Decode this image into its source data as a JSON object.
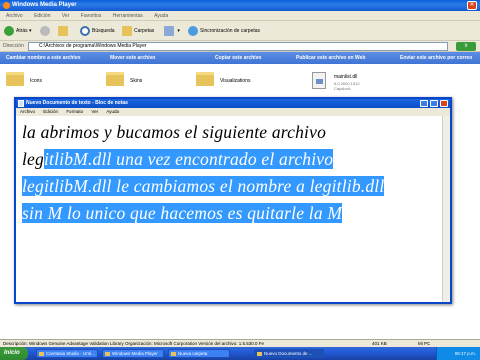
{
  "explorer": {
    "title": "Windows Media Player",
    "menu": [
      "Archivo",
      "Edición",
      "Ver",
      "Favoritos",
      "Herramientas",
      "Ayuda"
    ],
    "toolbar": {
      "back": "Atrás",
      "search": "Búsqueda",
      "folders": "Carpetas",
      "sync": "Sincronización de carpetas"
    },
    "address_label": "Dirección",
    "address_value": "C:\\Archivos de programa\\Windows Media Player",
    "go_label": "Ir",
    "tasks": [
      "Cambiar nombre a este archivo",
      "Mover este archivo",
      "Copiar este archivo",
      "Publicar este archivo en Web",
      "Enviar este archivo por correo"
    ],
    "items": [
      {
        "name": "Icons",
        "type": "folder"
      },
      {
        "name": "Skins",
        "type": "folder"
      },
      {
        "name": "Visualizations",
        "type": "folder"
      },
      {
        "name": "mainlist.dll",
        "meta1": "6.0.2600.1512",
        "meta2": "Capslock",
        "type": "file"
      }
    ]
  },
  "notepad": {
    "title": "Nuevo Documento de texto - Bloc de notas",
    "menu": [
      "Archivo",
      "Edición",
      "Formato",
      "Ver",
      "Ayuda"
    ],
    "lines": [
      {
        "plain": "la abrimos y bucamos el siguiente archivo",
        "selected": ""
      },
      {
        "plain": "leg",
        "selected": "itlibM.dll una vez encontrado el archivo"
      },
      {
        "plain": "",
        "selected": "legitlibM.dll le cambiamos el nombre a legitlib.dll"
      },
      {
        "plain": "",
        "selected": "sin M lo unico que hacemos es quitarle la M"
      }
    ]
  },
  "statusbar": {
    "description": "Descripción: Windows Genuine Advantage Validation Library Organización: Microsoft Corporation Versión del archivo: 1.5.530.0 Fe",
    "size": "401 KB",
    "location": "Mi PC"
  },
  "taskbar": {
    "start_label": "Inicio",
    "buttons": [
      "Camtasia Studio - Unti...",
      "Windows Media Player",
      "Nueva carpeta",
      "Nuevo Documento de ..."
    ],
    "clock": "06:17 p.m."
  },
  "colors": {
    "selection": "#3399ff",
    "titlebar": "#0a5fd8",
    "taskbar": "#245edb"
  }
}
